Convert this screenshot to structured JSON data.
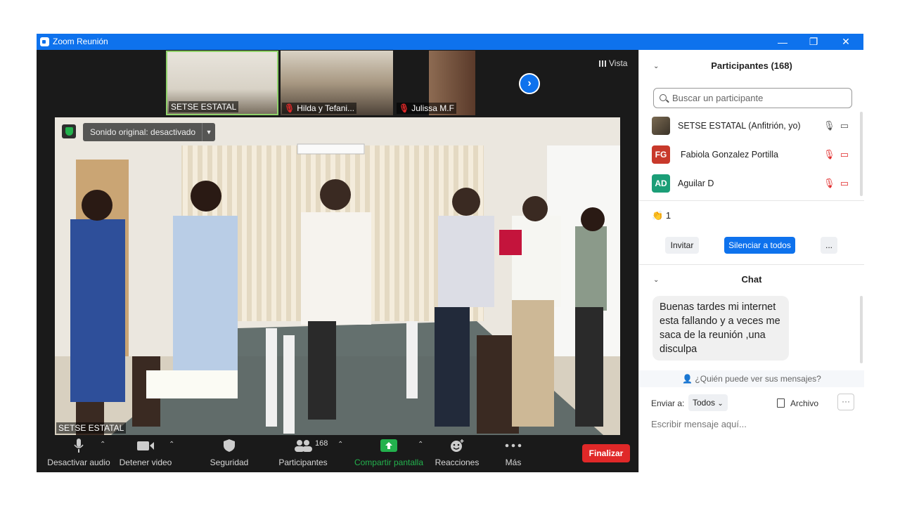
{
  "window": {
    "title": "Zoom Reunión",
    "controls": {
      "minimize": "—",
      "restore": "❐",
      "close": "✕"
    }
  },
  "video": {
    "view_button": "Vista",
    "thumbnails": [
      {
        "name": "SETSE ESTATAL",
        "muted": false
      },
      {
        "name": "Hilda y Tefani...",
        "muted": true
      },
      {
        "name": "Julissa M.F",
        "muted": true
      }
    ],
    "sound_pill": "Sonido original: desactivado",
    "main_speaker_label": "SETSE ESTATAL"
  },
  "toolbar": {
    "mute": "Desactivar audio",
    "video": "Detener video",
    "security": "Seguridad",
    "participants": "Participantes",
    "participants_count": "168",
    "share": "Compartir pantalla",
    "reactions": "Reacciones",
    "more": "Más",
    "end": "Finalizar",
    "colors": {
      "end": "#e02828",
      "share": "#23b14d",
      "accent": "#0e72ed"
    }
  },
  "participants_panel": {
    "header": "Participantes (168)",
    "search_placeholder": "Buscar un participante",
    "list": [
      {
        "name": "SETSE ESTATAL (Anfitrión, yo)",
        "initials": "",
        "color": "#5a5040"
      },
      {
        "name": "Fabiola Gonzalez Portilla",
        "initials": "FG",
        "color": "#c8392b"
      },
      {
        "name": "Aguilar D",
        "initials": "AD",
        "color": "#1b9e77"
      }
    ],
    "reaction": {
      "emoji": "👏",
      "count": "1"
    },
    "buttons": {
      "invite": "Invitar",
      "mute_all": "Silenciar a todos",
      "more": "..."
    }
  },
  "chat": {
    "header": "Chat",
    "message": "Buenas tardes mi internet esta fallando y a veces me saca de la reunión ,una disculpa",
    "who_can_see": "¿Quién puede ver sus mensajes?",
    "send_to_label": "Enviar a:",
    "send_to_value": "Todos",
    "file": "Archivo",
    "more": "···",
    "input_placeholder": "Escribir mensaje aquí..."
  }
}
